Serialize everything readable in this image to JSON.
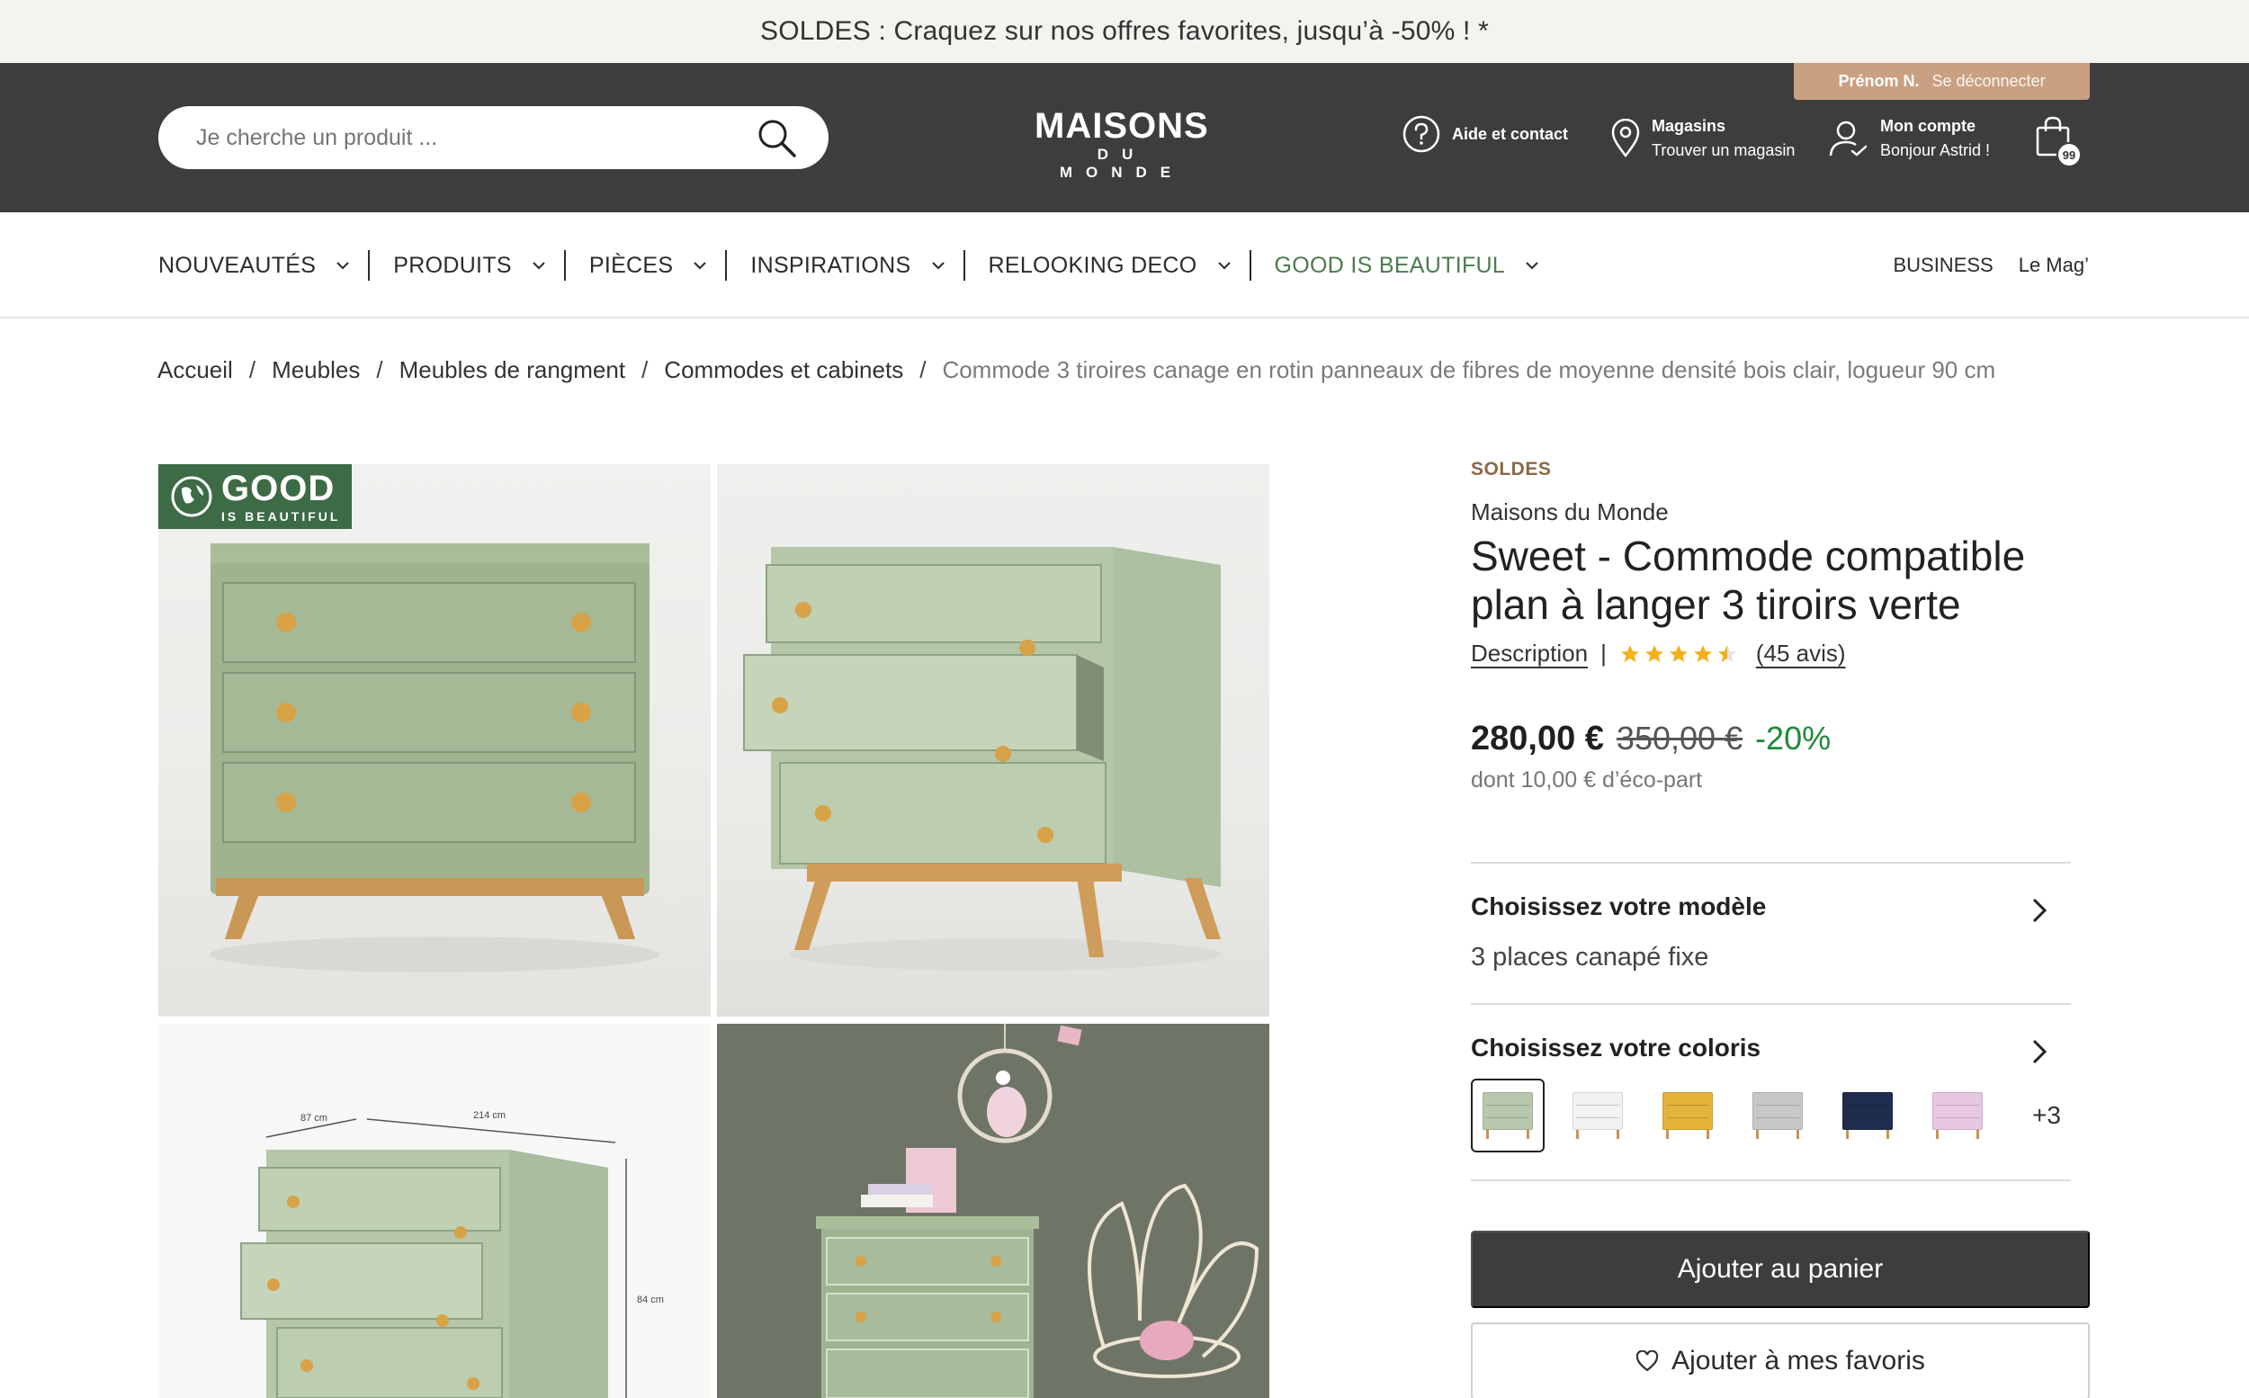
{
  "promo": {
    "text": "SOLDES : Craquez sur nos offres favorites, jusqu’à -50% ! *"
  },
  "header": {
    "user_name": "Prénom N.",
    "logout": "Se déconnecter",
    "search_placeholder": "Je cherche un produit ...",
    "logo_line1": "MAISONS",
    "logo_line2": "DU MONDE",
    "help": "Aide et contact",
    "stores_title": "Magasins",
    "stores_sub": "Trouver un magasin",
    "account_title": "Mon compte",
    "account_sub": "Bonjour Astrid !",
    "cart_count": "99",
    "icons": [
      "search-icon",
      "help-icon",
      "location-icon",
      "account-icon",
      "cart-icon"
    ]
  },
  "nav": {
    "items": [
      {
        "label": "NOUVEAUTÉS"
      },
      {
        "label": "PRODUITS"
      },
      {
        "label": "PIÈCES"
      },
      {
        "label": "INSPIRATIONS"
      },
      {
        "label": "RELOOKING DECO"
      },
      {
        "label": "GOOD IS BEAUTIFUL"
      }
    ],
    "right": [
      "BUSINESS",
      "Le Mag’"
    ],
    "accent_green": "#4b7a50"
  },
  "breadcrumb": [
    "Accueil",
    "Meubles",
    "Meubles de rangment",
    "Commodes et cabinets",
    "Commode 3 tiroires canage en rotin panneaux de fibres de moyenne densité bois clair, logueur 90 cm"
  ],
  "gallery": {
    "badge_line1": "GOOD",
    "badge_line2": "IS BEAUTIFUL",
    "dims": {
      "depth": "87 cm",
      "width": "214 cm",
      "height": "84 cm"
    }
  },
  "product": {
    "sale_tag": "SOLDES",
    "brand": "Maisons du Monde",
    "title": "Sweet - Commode compatible plan à langer 3 tiroirs verte",
    "description_link": "Description",
    "rating": 4.5,
    "reviews": "(45 avis)",
    "price": "280,00 €",
    "old_price": "350,00 €",
    "discount": "-20%",
    "eco_part": "dont 10,00 € d’éco-part"
  },
  "options": {
    "model_title": "Choisissez votre modèle",
    "model_value": "3 places canapé fixe",
    "color_title": "Choisissez votre coloris",
    "colors": [
      "#b9c7ad",
      "#f2f2f2",
      "#e4b43a",
      "#c8c8c6",
      "#1f2c4d",
      "#e8c7e3"
    ],
    "more_colors": "+3"
  },
  "actions": {
    "add_to_cart": "Ajouter au panier",
    "add_to_favorites": "Ajouter à mes favoris"
  }
}
